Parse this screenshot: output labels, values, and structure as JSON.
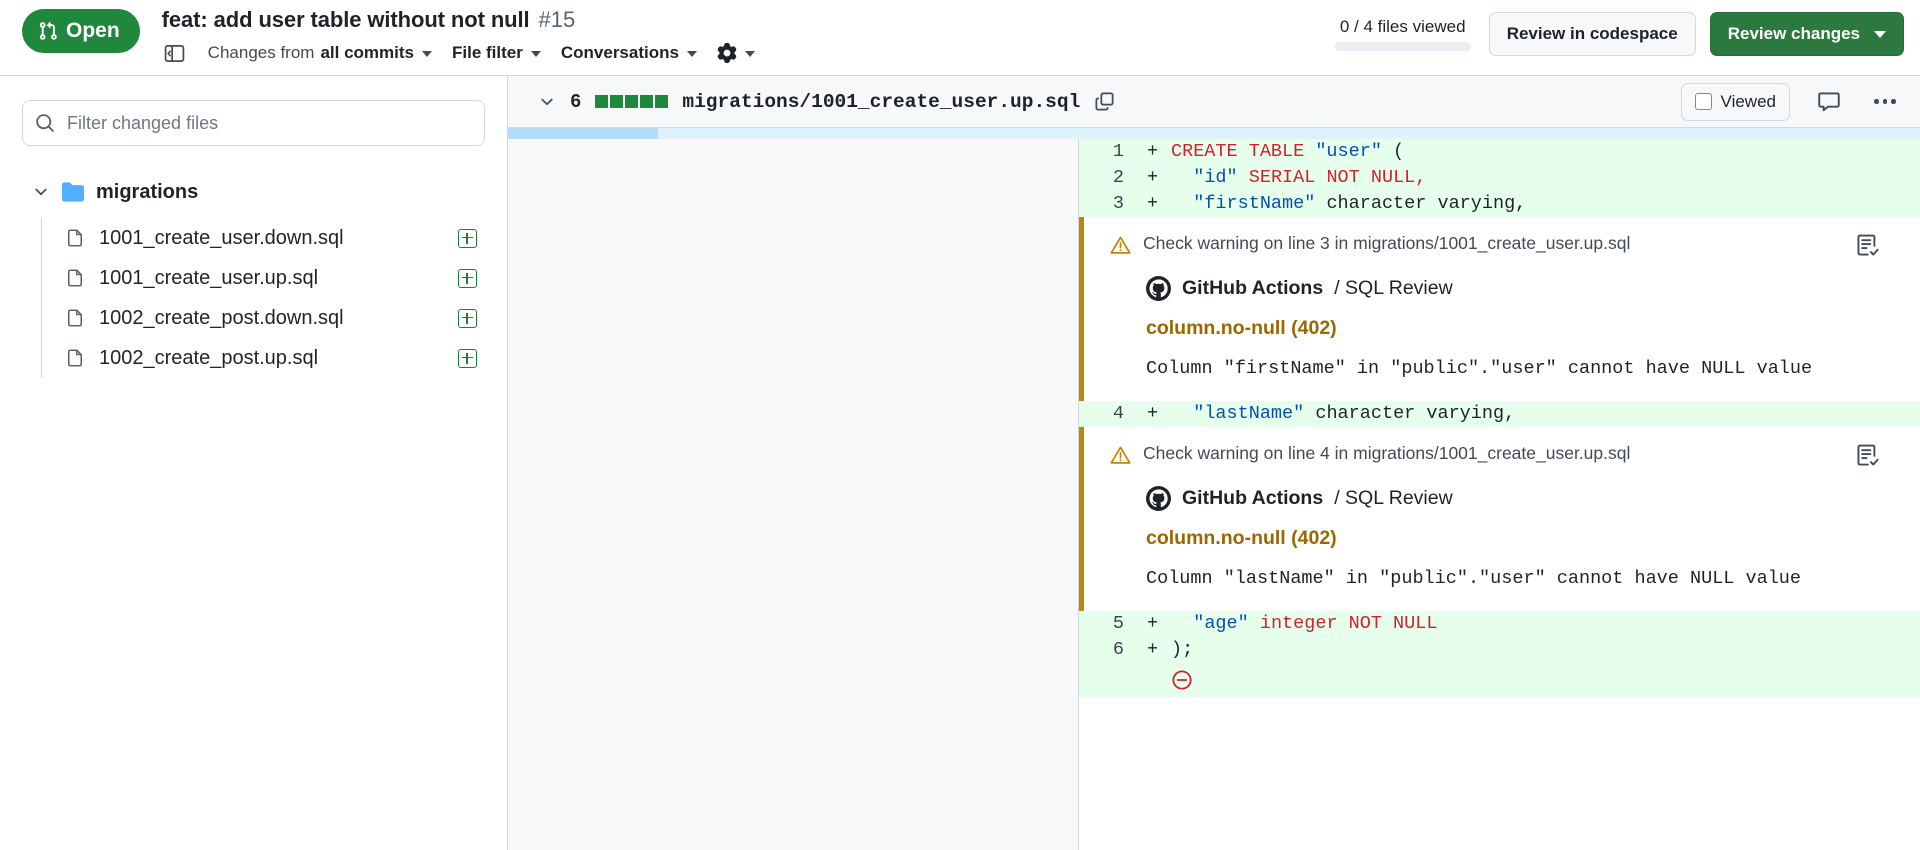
{
  "header": {
    "state_label": "Open",
    "state_icon": "git-pull-request-icon",
    "pr_title": "feat: add user table without not null",
    "pr_number": "#15",
    "sidebar_toggle_icon": "sidebar-expand-icon",
    "changes_from_label": "Changes from",
    "changes_from_value": "all commits",
    "file_filter_label": "File filter",
    "conversations_label": "Conversations",
    "settings_icon": "gear-icon",
    "files_viewed_text": "0 / 4 files viewed",
    "review_codespace_label": "Review in codespace",
    "review_changes_label": "Review changes"
  },
  "sidebar": {
    "filter_placeholder": "Filter changed files",
    "filter_value": "",
    "search_icon": "search-icon",
    "folder": {
      "name": "migrations",
      "icon": "folder-icon",
      "chevron": "chevron-down-icon"
    },
    "files": [
      {
        "name": "1001_create_user.down.sql",
        "icon": "file-icon",
        "status": "added",
        "status_icon": "plus-square-icon"
      },
      {
        "name": "1001_create_user.up.sql",
        "icon": "file-icon",
        "status": "added",
        "status_icon": "plus-square-icon"
      },
      {
        "name": "1002_create_post.down.sql",
        "icon": "file-icon",
        "status": "added",
        "status_icon": "plus-square-icon"
      },
      {
        "name": "1002_create_post.up.sql",
        "icon": "file-icon",
        "status": "added",
        "status_icon": "plus-square-icon"
      }
    ]
  },
  "diff": {
    "file_header": {
      "chevron": "chevron-down-icon",
      "change_count": "6",
      "diffstat_blocks": 5,
      "path": "migrations/1001_create_user.up.sql",
      "copy_icon": "copy-icon",
      "viewed_label": "Viewed",
      "comment_icon": "comment-icon",
      "more_icon": "kebab-horizontal-icon"
    },
    "rows": [
      {
        "kind": "code",
        "line": "1",
        "sign": "+",
        "tokens": [
          {
            "t": "CREATE TABLE ",
            "c": "kw"
          },
          {
            "t": "\"user\"",
            "c": "str"
          },
          {
            "t": " (",
            "c": "pl"
          }
        ]
      },
      {
        "kind": "code",
        "line": "2",
        "sign": "+",
        "tokens": [
          {
            "t": "  ",
            "c": "pl"
          },
          {
            "t": "\"id\"",
            "c": "str"
          },
          {
            "t": " SERIAL NOT NULL,",
            "c": "kw"
          }
        ]
      },
      {
        "kind": "code",
        "line": "3",
        "sign": "+",
        "tokens": [
          {
            "t": "  ",
            "c": "pl"
          },
          {
            "t": "\"firstName\"",
            "c": "str"
          },
          {
            "t": " character varying,",
            "c": "pl"
          }
        ]
      },
      {
        "kind": "annotation",
        "warn_icon": "alert-triangle-icon",
        "head": "Check warning on line 3 in migrations/1001_create_user.up.sql",
        "head_btn_icon": "checklist-icon",
        "actor_icon": "github-mark-icon",
        "actor": "GitHub Actions",
        "check_name": "/ SQL Review",
        "rule": "column.no-null (402)",
        "message": "Column \"firstName\" in \"public\".\"user\" cannot have NULL value"
      },
      {
        "kind": "code",
        "line": "4",
        "sign": "+",
        "tokens": [
          {
            "t": "  ",
            "c": "pl"
          },
          {
            "t": "\"lastName\"",
            "c": "str"
          },
          {
            "t": " character varying,",
            "c": "pl"
          }
        ]
      },
      {
        "kind": "annotation",
        "warn_icon": "alert-triangle-icon",
        "head": "Check warning on line 4 in migrations/1001_create_user.up.sql",
        "head_btn_icon": "checklist-icon",
        "actor_icon": "github-mark-icon",
        "actor": "GitHub Actions",
        "check_name": "/ SQL Review",
        "rule": "column.no-null (402)",
        "message": "Column \"lastName\" in \"public\".\"user\" cannot have NULL value"
      },
      {
        "kind": "code",
        "line": "5",
        "sign": "+",
        "tokens": [
          {
            "t": "  ",
            "c": "pl"
          },
          {
            "t": "\"age\"",
            "c": "str"
          },
          {
            "t": " integer NOT NULL",
            "c": "kw"
          }
        ]
      },
      {
        "kind": "code",
        "line": "6",
        "sign": "+",
        "tokens": [
          {
            "t": ");",
            "c": "pl"
          }
        ]
      },
      {
        "kind": "collapse",
        "icon": "minus-circle-icon"
      }
    ]
  },
  "colors": {
    "open_green": "#1f883d",
    "primary_button": "#2c793f",
    "addition_bg": "#e6ffec",
    "warning_border": "#bf8700",
    "rule_text": "#9a6700",
    "keyword": "#cf222e",
    "string": "#0550ae",
    "scroll_track": "#ddf4ff",
    "scroll_thumb": "#b6dcfb"
  }
}
